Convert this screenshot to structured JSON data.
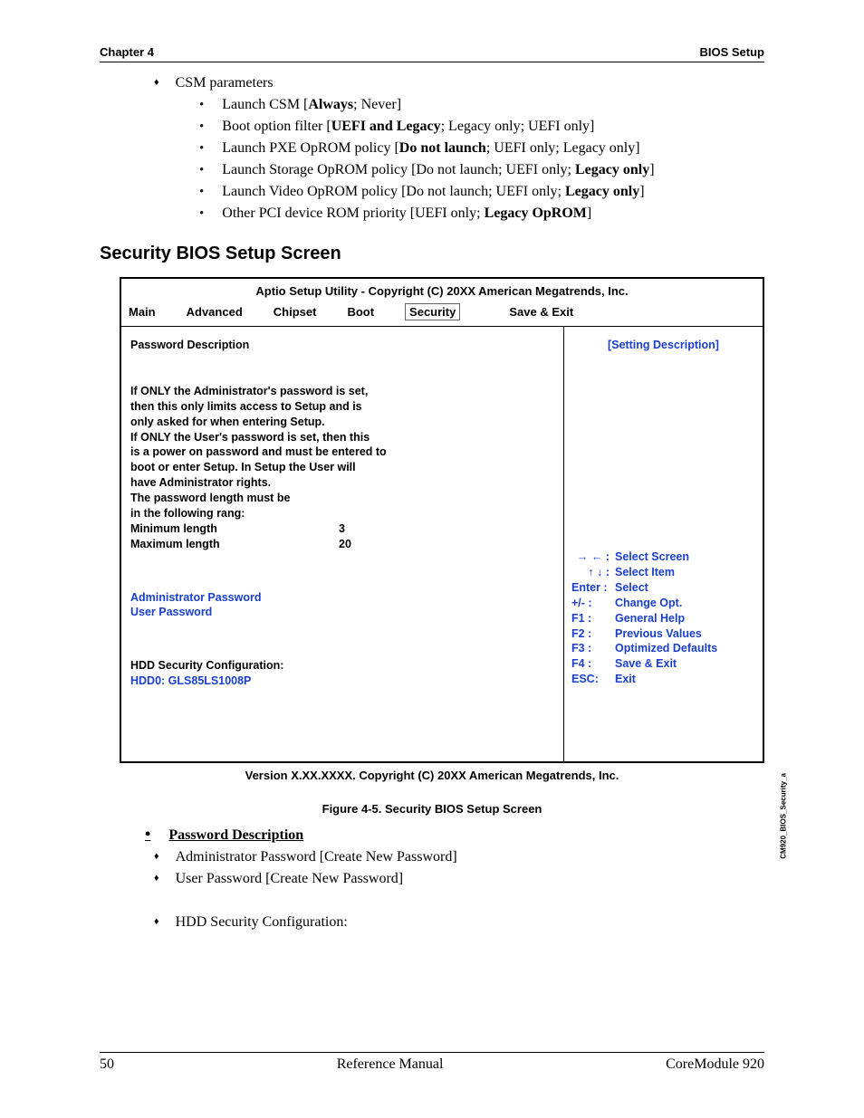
{
  "header": {
    "left": "Chapter 4",
    "right": "BIOS Setup"
  },
  "csm": {
    "title": "CSM parameters",
    "items": [
      {
        "pre": "Launch CSM [",
        "bold": "Always",
        "post": "; Never]"
      },
      {
        "pre": "Boot option filter [",
        "bold": "UEFI and Legacy",
        "post": "; Legacy only; UEFI only]"
      },
      {
        "pre": "Launch PXE OpROM policy [",
        "bold": "Do not launch",
        "post": "; UEFI only; Legacy only]"
      },
      {
        "pre": "Launch Storage OpROM policy [Do not launch; UEFI only; ",
        "bold": "Legacy only",
        "post": "]"
      },
      {
        "pre": "Launch Video OpROM policy [Do not launch; UEFI only; ",
        "bold": "Legacy only",
        "post": "]"
      },
      {
        "pre": "Other PCI device ROM priority [UEFI only; ",
        "bold": "Legacy OpROM",
        "post": "]"
      }
    ]
  },
  "heading": "Security BIOS Setup Screen",
  "bios": {
    "title": "Aptio Setup Utility   -   Copyright (C) 20XX American Megatrends, Inc.",
    "menu": [
      "Main",
      "Advanced",
      "Chipset",
      "Boot",
      "Security",
      "Save & Exit"
    ],
    "selected": "Security",
    "left": {
      "pwd_desc_label": "Password Description",
      "p1": "If ONLY the Administrator's password is set,",
      "p2": "then this only limits access to Setup and is",
      "p3": "only asked for when entering Setup.",
      "p4": "If ONLY the User's password is set, then this",
      "p5": "is a power on password and must be entered to",
      "p6": "boot or enter Setup. In Setup the User will",
      "p7": "have Administrator rights.",
      "p8": "The password length must be",
      "p9": "in the following rang:",
      "min_label": "Minimum length",
      "min_val": "3",
      "max_label": "Maximum length",
      "max_val": "20",
      "admin_pw": "Administrator Password",
      "user_pw": "User Password",
      "hdd_cfg": "HDD Security Configuration:",
      "hdd0": "HDD0: GLS85LS1008P"
    },
    "right": {
      "setting_desc": "[Setting Description]",
      "k1a": "→ ← :",
      "k1b": "Select Screen",
      "k2a": "↑ ↓  :",
      "k2b": "Select Item",
      "k3a": "Enter :",
      "k3b": "Select",
      "k4a": "+/- :",
      "k4b": "Change Opt.",
      "k5a": "F1 :",
      "k5b": "General Help",
      "k6a": "F2 :",
      "k6b": "Previous Values",
      "k7a": "F3 :",
      "k7b": "Optimized Defaults",
      "k8a": "F4 :",
      "k8b": "Save & Exit",
      "k9a": "ESC:",
      "k9b": "Exit"
    },
    "footer": "Version X.XX.XXXX.  Copyright (C) 20XX  American Megatrends, Inc.",
    "side_label": "CM920_BIOS_Security_a"
  },
  "fig_caption": "Figure  4-5.   Security BIOS Setup Screen",
  "lower": {
    "pwd_desc": "Password Description",
    "items": [
      "Administrator Password [Create New Password]",
      "User Password [Create New Password]",
      "HDD Security Configuration:"
    ]
  },
  "footer": {
    "left": "50",
    "center": "Reference Manual",
    "right": "CoreModule 920"
  }
}
